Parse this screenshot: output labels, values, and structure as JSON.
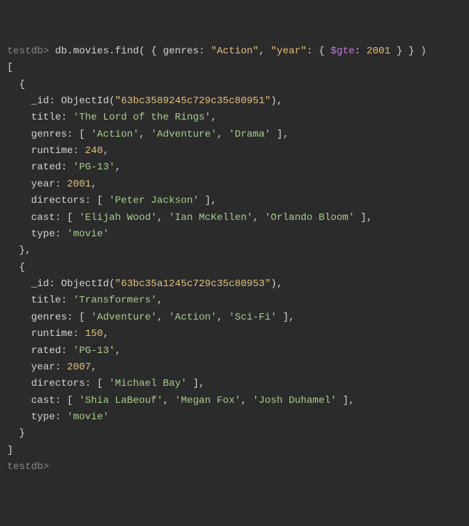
{
  "prompt1": "testdb>",
  "prompt2": "testdb>",
  "cmd": {
    "db": "db",
    "coll": "movies",
    "method": "find",
    "open": "( {",
    "k1": "genres",
    "v1": "\"Action\"",
    "k2": "\"year\"",
    "op": "$gte",
    "v2": "2001",
    "close": "} } )"
  },
  "r": [
    {
      "_id": "63bc3589245c729c35c80951",
      "title": "The Lord of the Rings",
      "genres": [
        "Action",
        "Adventure",
        "Drama"
      ],
      "runtime": "240",
      "rated": "PG-13",
      "year": "2001",
      "directors": [
        "Peter Jackson"
      ],
      "cast": [
        "Elijah Wood",
        "Ian McKellen",
        "Orlando Bloom"
      ],
      "type": "movie"
    },
    {
      "_id": "63bc35a1245c729c35c80953",
      "title": "Transformers",
      "genres": [
        "Adventure",
        "Action",
        "Sci-Fi"
      ],
      "runtime": "150",
      "rated": "PG-13",
      "year": "2007",
      "directors": [
        "Michael Bay"
      ],
      "cast": [
        "Shia LaBeouf",
        "Megan Fox",
        "Josh Duhamel"
      ],
      "type": "movie"
    }
  ],
  "lbl": {
    "_id": "_id",
    "oid": "ObjectId",
    "title": "title",
    "genres": "genres",
    "runtime": "runtime",
    "rated": "rated",
    "year": "year",
    "directors": "directors",
    "cast": "cast",
    "type": "type"
  }
}
